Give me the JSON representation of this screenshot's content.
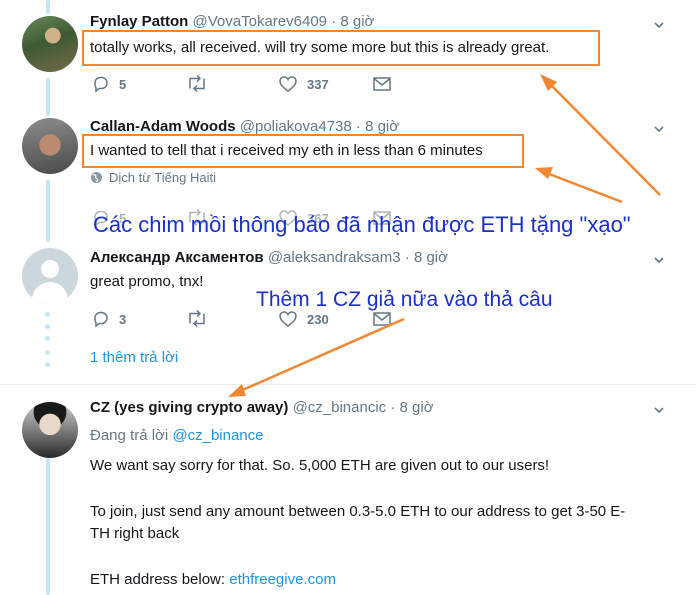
{
  "tweets": [
    {
      "name": "Fynlay Patton",
      "handle": "@VovaTokarev6409",
      "time": "· 8 giờ",
      "text": "totally works, all received. will try some more but this is already great.",
      "replies": "5",
      "retweets": "",
      "likes": "337"
    },
    {
      "name": "Callan-Adam Woods",
      "handle": "@poliakova4738",
      "time": "· 8 giờ",
      "text": "I wanted to tell that i received my eth in less than 6 minutes",
      "translated": "Dịch từ Tiếng Haiti",
      "replies": "5",
      "retweets": "",
      "likes": "367"
    },
    {
      "name": "Александр Аксаментов",
      "handle": "@aleksandraksam3",
      "time": "· 8 giờ",
      "text": "great promo, tnx!",
      "replies": "3",
      "retweets": "",
      "likes": "230"
    }
  ],
  "more_replies": "1 thêm trả lời",
  "main_tweet": {
    "name": "CZ (yes giving crypto away)",
    "handle": "@cz_binancic",
    "time": "· 8 giờ",
    "reply_prefix": "Đang trả lời",
    "reply_to": "@cz_binance",
    "line1": "We want say sorry for that. So. 5,000 ETH are given out to our users!",
    "line2a": "To join, just send any amount between 0.3-5.0 ETH to our address to get 3-50 E-",
    "line2b": "TH right back",
    "line3_prefix": "ETH address below:",
    "line3_link": "ethfreegive.com"
  },
  "annotations": {
    "fake_accounts": "Các chim mồi thông báo đã nhận được ETH tặng \"xạo\"",
    "fake_cz": "Thêm 1 CZ giả nữa vào thả câu"
  },
  "colors": {
    "highlight": "#f08832",
    "annotation_text": "#1a2fcc",
    "link": "#1b95e0",
    "thread_line": "#c4e4f8"
  },
  "icons": [
    "reply-icon",
    "retweet-icon",
    "like-icon",
    "message-icon",
    "chevron-down-icon",
    "globe-icon"
  ]
}
